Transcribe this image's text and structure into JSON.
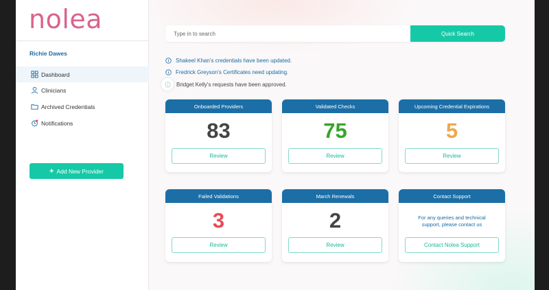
{
  "logo": "nolea",
  "user": {
    "name": "Richie Dawes"
  },
  "nav": [
    {
      "label": "Dashboard",
      "icon": "grid-icon"
    },
    {
      "label": "Clinicians",
      "icon": "user-icon"
    },
    {
      "label": "Archived Credentials",
      "icon": "folder-icon"
    },
    {
      "label": "Notifications",
      "icon": "bell-icon"
    }
  ],
  "add_provider": {
    "label": "Add New Provider"
  },
  "search": {
    "placeholder": "Type in to search",
    "button": "Quick Search"
  },
  "notifications": [
    "Shakeel Khan's credentials have been updated.",
    "Fredrick Greyson's Certificates need updating.",
    "Bridget Kelly's requests have been approved."
  ],
  "cards": [
    {
      "title": "Onboarded Providers",
      "value": "83",
      "button": "Review",
      "value_color": "#444444"
    },
    {
      "title": "Validated Checks",
      "value": "75",
      "button": "Review",
      "value_color": "#36a52a"
    },
    {
      "title": "Upcoming Credential Expirations",
      "value": "5",
      "button": "Review",
      "value_color": "#efa84a"
    },
    {
      "title": "Failed Validations",
      "value": "3",
      "button": "Review",
      "value_color": "#e84c57"
    },
    {
      "title": "March Renewals",
      "value": "2",
      "button": "Review",
      "value_color": "#444444"
    },
    {
      "title": "Contact Support",
      "text": "For any queries and technical support, please contact us",
      "button": "Contact Nolea Support"
    }
  ],
  "colors": {
    "brand": "#d9638d",
    "accent": "#16c9a6",
    "header": "#1c6ea6",
    "link": "#1a6aa1"
  }
}
